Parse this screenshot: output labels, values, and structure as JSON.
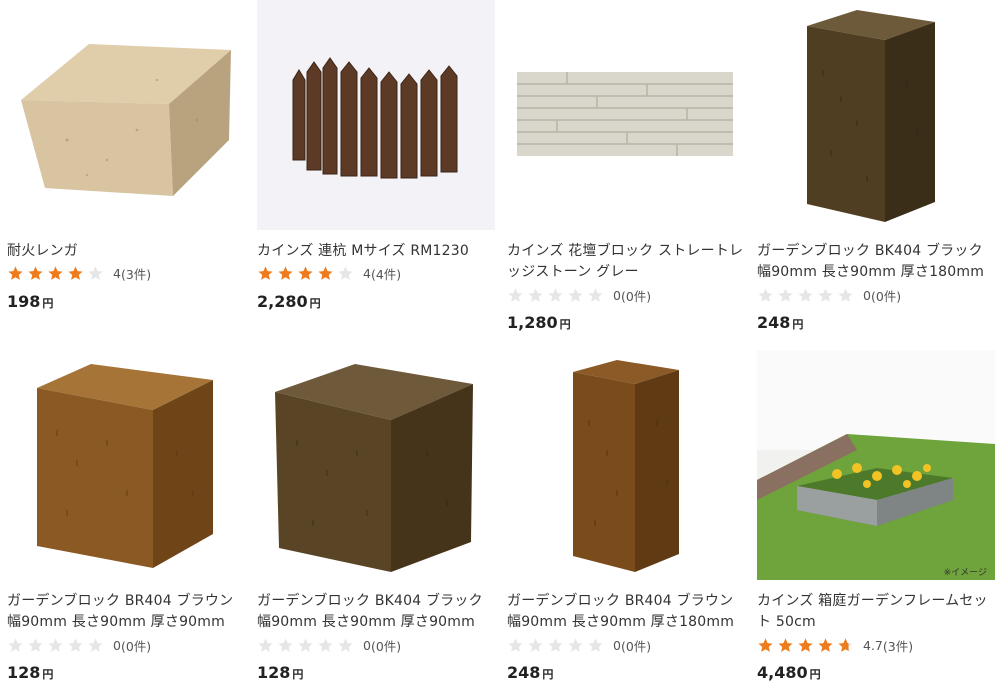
{
  "products": [
    {
      "title": "耐火レンガ",
      "rating_value": 4.0,
      "rating_text": "4",
      "review_count": "(3件)",
      "price": "198",
      "currency": "円",
      "image_icon": "refractory-brick-image"
    },
    {
      "title": "カインズ 連杭 Mサイズ RM1230",
      "rating_value": 4.0,
      "rating_text": "4",
      "review_count": "(4件)",
      "price": "2,280",
      "currency": "円",
      "image_icon": "wooden-stake-edging-image"
    },
    {
      "title": "カインズ 花壇ブロック ストレートレッジストーン グレー",
      "rating_value": 0,
      "rating_text": "0",
      "review_count": "(0件)",
      "price": "1,280",
      "currency": "円",
      "image_icon": "ledgestone-panel-image"
    },
    {
      "title": "ガーデンブロック BK404 ブラック 幅90mm 長さ90mm 厚さ180mm",
      "rating_value": 0,
      "rating_text": "0",
      "review_count": "(0件)",
      "price": "248",
      "currency": "円",
      "image_icon": "black-wood-block-tall-image"
    },
    {
      "title": "ガーデンブロック BR404 ブラウン 幅90mm 長さ90mm 厚さ90mm",
      "rating_value": 0,
      "rating_text": "0",
      "review_count": "(0件)",
      "price": "128",
      "currency": "円",
      "image_icon": "brown-wood-cube-image"
    },
    {
      "title": "ガーデンブロック BK404 ブラック 幅90mm 長さ90mm 厚さ90mm",
      "rating_value": 0,
      "rating_text": "0",
      "review_count": "(0件)",
      "price": "128",
      "currency": "円",
      "image_icon": "black-wood-cube-image"
    },
    {
      "title": "ガーデンブロック BR404 ブラウン 幅90mm 長さ90mm 厚さ180mm",
      "rating_value": 0,
      "rating_text": "0",
      "review_count": "(0件)",
      "price": "248",
      "currency": "円",
      "image_icon": "brown-wood-block-tall-image"
    },
    {
      "title": "カインズ 箱庭ガーデンフレームセット 50cm",
      "rating_value": 4.7,
      "rating_text": "4.7",
      "review_count": "(3件)",
      "price": "4,480",
      "currency": "円",
      "image_icon": "garden-frame-set-image",
      "image_note": "※イメージ"
    }
  ],
  "colors": {
    "star_filled": "#ee7b1d",
    "star_empty": "#e6e6e6",
    "text": "#333333"
  }
}
